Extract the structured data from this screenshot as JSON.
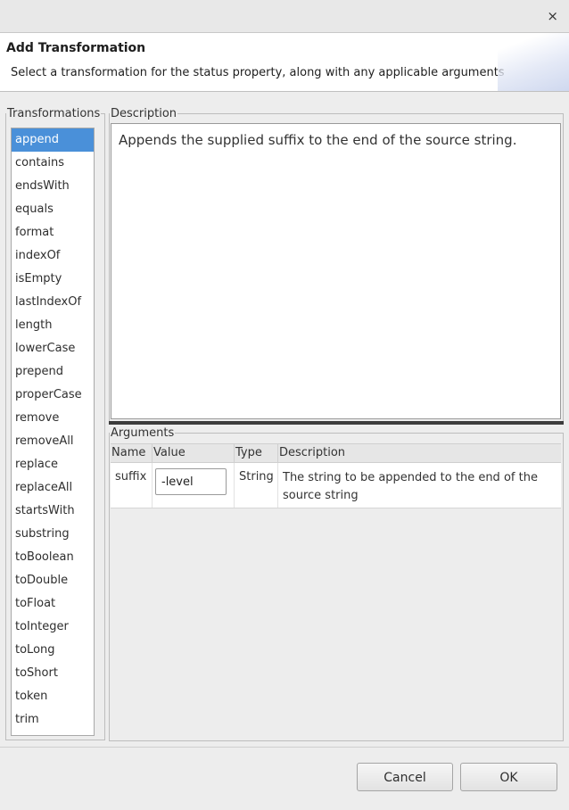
{
  "window": {
    "close_glyph": "×"
  },
  "header": {
    "title": "Add Transformation",
    "subtitle": "Select a transformation for the status property, along with any applicable arguments"
  },
  "transformations": {
    "legend": "Transformations",
    "selected": "append",
    "items": [
      "append",
      "contains",
      "endsWith",
      "equals",
      "format",
      "indexOf",
      "isEmpty",
      "lastIndexOf",
      "length",
      "lowerCase",
      "prepend",
      "properCase",
      "remove",
      "removeAll",
      "replace",
      "replaceAll",
      "startsWith",
      "substring",
      "toBoolean",
      "toDouble",
      "toFloat",
      "toInteger",
      "toLong",
      "toShort",
      "token",
      "trim"
    ]
  },
  "description": {
    "legend": "Description",
    "text": "Appends the supplied suffix to the end of the source string."
  },
  "arguments": {
    "legend": "Arguments",
    "columns": {
      "name": "Name",
      "value": "Value",
      "type": "Type",
      "description": "Description"
    },
    "rows": [
      {
        "name": "suffix",
        "value": "-level",
        "type": "String",
        "description": "The string to be appended to the end of the source string"
      }
    ]
  },
  "buttons": {
    "cancel": "Cancel",
    "ok": "OK"
  }
}
